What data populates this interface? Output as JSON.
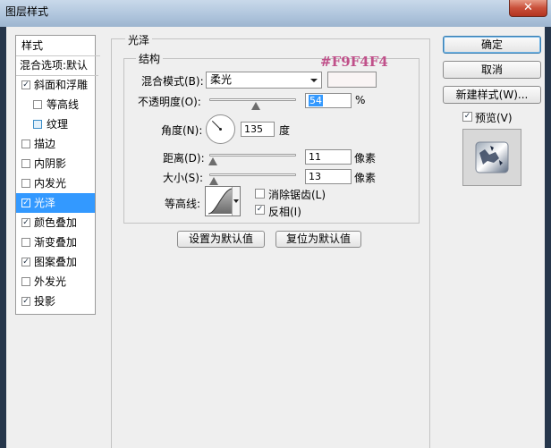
{
  "window": {
    "title": "图层样式",
    "close_glyph": "✕"
  },
  "left_panel": {
    "header": "样式",
    "blend_options": "混合选项:默认",
    "items": [
      {
        "label": "斜面和浮雕",
        "checked": true,
        "indent": false,
        "selected": false
      },
      {
        "label": "等高线",
        "checked": false,
        "indent": true,
        "selected": false
      },
      {
        "label": "纹理",
        "checked": false,
        "indent": true,
        "selected": false,
        "blue": true
      },
      {
        "label": "描边",
        "checked": false,
        "indent": false,
        "selected": false
      },
      {
        "label": "内阴影",
        "checked": false,
        "indent": false,
        "selected": false
      },
      {
        "label": "内发光",
        "checked": false,
        "indent": false,
        "selected": false
      },
      {
        "label": "光泽",
        "checked": true,
        "indent": false,
        "selected": true
      },
      {
        "label": "颜色叠加",
        "checked": true,
        "indent": false,
        "selected": false
      },
      {
        "label": "渐变叠加",
        "checked": false,
        "indent": false,
        "selected": false
      },
      {
        "label": "图案叠加",
        "checked": true,
        "indent": false,
        "selected": false
      },
      {
        "label": "外发光",
        "checked": false,
        "indent": false,
        "selected": false
      },
      {
        "label": "投影",
        "checked": true,
        "indent": false,
        "selected": false
      }
    ]
  },
  "satin": {
    "group_title": "光泽",
    "structure_title": "结构",
    "blend_mode_label": "混合模式(B):",
    "blend_mode_value": "柔光",
    "swatch_color": "#F9F4F4",
    "color_annotation": "#F9F4F4",
    "opacity_label": "不透明度(O):",
    "opacity_value": "54",
    "opacity_unit": "%",
    "opacity_fraction": 0.54,
    "angle_label": "角度(N):",
    "angle_value": "135",
    "angle_unit": "度",
    "distance_label": "距离(D):",
    "distance_value": "11",
    "distance_unit": "像素",
    "distance_fraction": 0.04,
    "size_label": "大小(S):",
    "size_value": "13",
    "size_unit": "像素",
    "size_fraction": 0.05,
    "contour_label": "等高线:",
    "antialias_label": "消除锯齿(L)",
    "antialias_checked": false,
    "invert_label": "反相(I)",
    "invert_checked": true,
    "make_default_label": "设置为默认值",
    "reset_default_label": "复位为默认值"
  },
  "right_buttons": {
    "ok_label": "确定",
    "cancel_label": "取消",
    "new_style_label": "新建样式(W)...",
    "preview_label": "预览(V)",
    "preview_checked": true
  },
  "colors": {
    "selection": "#3399ff",
    "annotation": "#c0508a",
    "opacity_highlight": "#3399ff"
  }
}
